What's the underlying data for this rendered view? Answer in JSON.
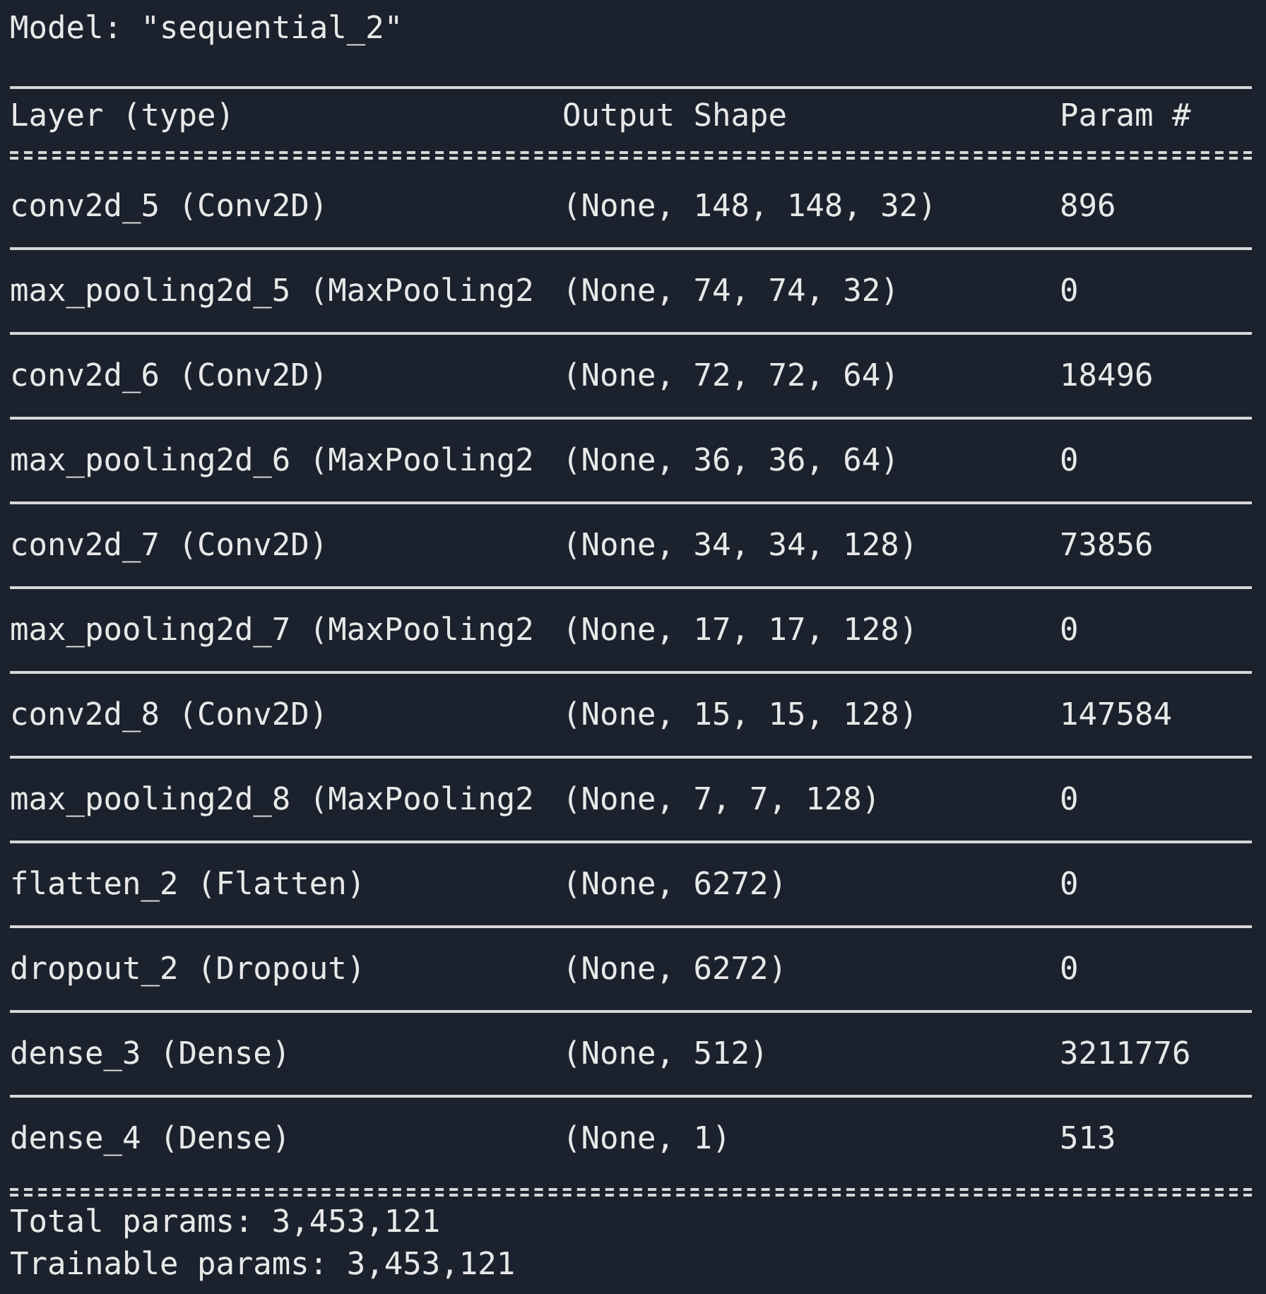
{
  "model_title": "Model: \"sequential_2\"",
  "table": {
    "columns": [
      "Layer (type)",
      "Output Shape",
      "Param #"
    ],
    "rows": [
      {
        "layer": "conv2d_5 (Conv2D)",
        "output_shape": "(None, 148, 148, 32)",
        "params": "896"
      },
      {
        "layer": "max_pooling2d_5 (MaxPooling2",
        "output_shape": "(None, 74, 74, 32)",
        "params": "0"
      },
      {
        "layer": "conv2d_6 (Conv2D)",
        "output_shape": "(None, 72, 72, 64)",
        "params": "18496"
      },
      {
        "layer": "max_pooling2d_6 (MaxPooling2",
        "output_shape": "(None, 36, 36, 64)",
        "params": "0"
      },
      {
        "layer": "conv2d_7 (Conv2D)",
        "output_shape": "(None, 34, 34, 128)",
        "params": "73856"
      },
      {
        "layer": "max_pooling2d_7 (MaxPooling2",
        "output_shape": "(None, 17, 17, 128)",
        "params": "0"
      },
      {
        "layer": "conv2d_8 (Conv2D)",
        "output_shape": "(None, 15, 15, 128)",
        "params": "147584"
      },
      {
        "layer": "max_pooling2d_8 (MaxPooling2",
        "output_shape": "(None, 7, 7, 128)",
        "params": "0"
      },
      {
        "layer": "flatten_2 (Flatten)",
        "output_shape": "(None, 6272)",
        "params": "0"
      },
      {
        "layer": "dropout_2 (Dropout)",
        "output_shape": "(None, 6272)",
        "params": "0"
      },
      {
        "layer": "dense_3 (Dense)",
        "output_shape": "(None, 512)",
        "params": "3211776"
      },
      {
        "layer": "dense_4 (Dense)",
        "output_shape": "(None, 1)",
        "params": "513"
      }
    ]
  },
  "summary": [
    "Total params: 3,453,121",
    "Trainable params: 3,453,121"
  ]
}
